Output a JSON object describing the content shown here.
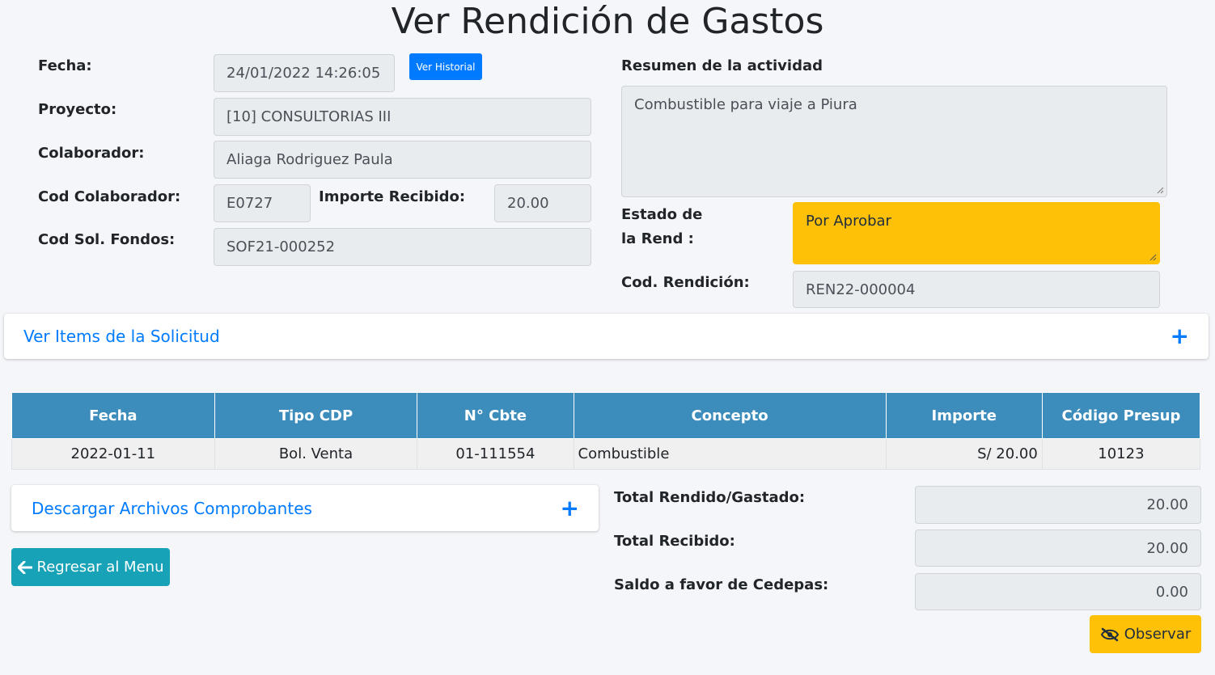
{
  "page": {
    "title": "Ver Rendición de Gastos"
  },
  "form": {
    "fecha_label": "Fecha:",
    "fecha_value": "24/01/2022 14:26:05",
    "ver_historial": "Ver Historial",
    "proyecto_label": "Proyecto:",
    "proyecto_value": "[10] CONSULTORIAS III",
    "colaborador_label": "Colaborador:",
    "colaborador_value": "Aliaga Rodriguez Paula",
    "cod_colaborador_label": "Cod Colaborador:",
    "cod_colaborador_value": "E0727",
    "importe_recibido_label": "Importe Recibido:",
    "importe_recibido_value": "20.00",
    "cod_sol_label": "Cod Sol. Fondos:",
    "cod_sol_value": "SOF21-000252",
    "resumen_label": "Resumen de la actividad",
    "resumen_value": "Combustible para viaje a Piura",
    "estado_label_1": "Estado de",
    "estado_label_2": "la Rend :",
    "estado_value": "Por Aprobar",
    "cod_rendicion_label": "Cod. Rendición:",
    "cod_rendicion_value": "REN22-000004"
  },
  "cards": {
    "ver_items": "Ver Items de la Solicitud",
    "descargar": "Descargar Archivos Comprobantes",
    "plus": "+"
  },
  "table": {
    "headers": [
      "Fecha",
      "Tipo CDP",
      "N° Cbte",
      "Concepto",
      "Importe",
      "Código Presup"
    ],
    "rows": [
      [
        "2022-01-11",
        "Bol. Venta",
        "01-111554",
        "Combustible",
        "S/ 20.00",
        "10123"
      ]
    ]
  },
  "totals": {
    "rendido_label": "Total Rendido/Gastado:",
    "rendido_value": "20.00",
    "recibido_label": "Total Recibido:",
    "recibido_value": "20.00",
    "saldo_label": "Saldo a favor de Cedepas:",
    "saldo_value": "0.00"
  },
  "buttons": {
    "regresar": "Regresar al Menu",
    "observar": "Observar"
  },
  "colors": {
    "primary": "#007bff",
    "table_header": "#3c8dbc",
    "info": "#17a2b8",
    "warning": "#ffc107"
  },
  "icons": {
    "regresar": "arrow-left-icon",
    "observar": "eye-slash-icon",
    "expand": "plus-icon"
  }
}
